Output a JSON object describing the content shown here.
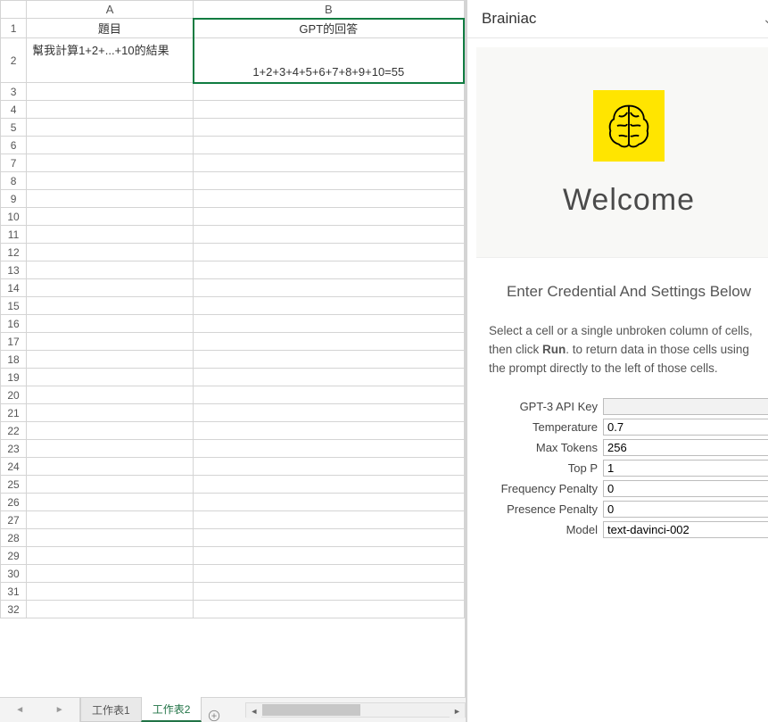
{
  "grid": {
    "columns": [
      "A",
      "B"
    ],
    "rows": {
      "r1": {
        "A": "題目",
        "B": "GPT的回答"
      },
      "r2": {
        "A": "幫我計算1+2+...+10的結果",
        "B": "1+2+3+4+5+6+7+8+9+10=55"
      }
    },
    "rowCount": 32
  },
  "tabs": {
    "items": [
      "工作表1",
      "工作表2"
    ],
    "activeIndex": 1
  },
  "panel": {
    "title": "Brainiac",
    "welcome": "Welcome",
    "settingsHead": "Enter Credential And Settings Below",
    "desc_pre": "Select a cell or a single unbroken column of cells, then click ",
    "desc_bold": "Run",
    "desc_post": ". to return data in those cells using the prompt directly to the left of those cells.",
    "fields": {
      "apiKey": {
        "label": "GPT-3 API Key",
        "value": ""
      },
      "temperature": {
        "label": "Temperature",
        "value": "0.7"
      },
      "maxTokens": {
        "label": "Max Tokens",
        "value": "256"
      },
      "topP": {
        "label": "Top P",
        "value": "1"
      },
      "freqPenalty": {
        "label": "Frequency Penalty",
        "value": "0"
      },
      "presPenalty": {
        "label": "Presence Penalty",
        "value": "0"
      },
      "model": {
        "label": "Model",
        "value": "text-davinci-002"
      }
    }
  }
}
